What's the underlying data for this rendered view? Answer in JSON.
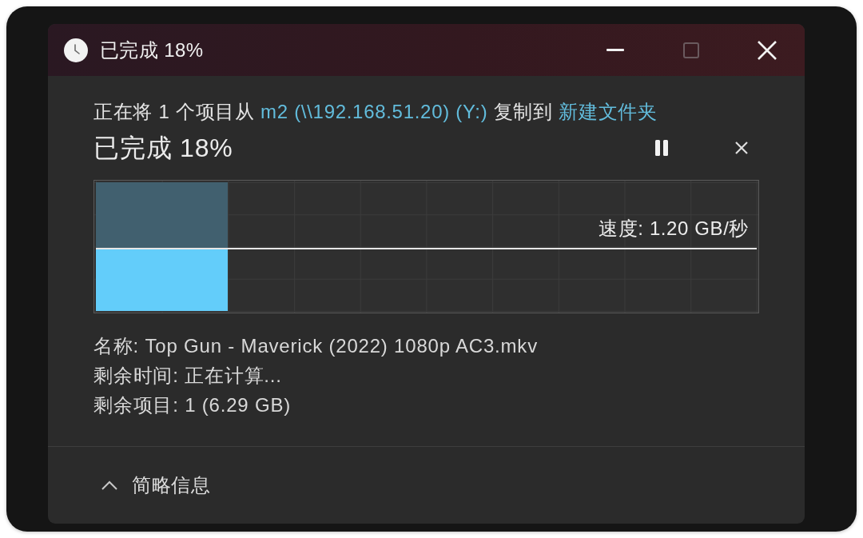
{
  "window": {
    "title": "已完成 18%",
    "controls": [
      {
        "kind": "minimize",
        "disabled": false
      },
      {
        "kind": "maximize",
        "disabled": true
      },
      {
        "kind": "close",
        "disabled": false
      }
    ]
  },
  "operation": {
    "parts": [
      {
        "kind": "text",
        "text": "正在将 1 个项目从"
      },
      {
        "kind": "link",
        "text": "m2 (\\\\192.168.51.20) (Y:)"
      },
      {
        "kind": "text",
        "text": "复制到"
      },
      {
        "kind": "link",
        "text": "新建文件夹"
      }
    ]
  },
  "status": {
    "text": "已完成 18%",
    "actions": [
      {
        "kind": "pause"
      },
      {
        "kind": "cancel"
      }
    ]
  },
  "progress": {
    "level": 0.2,
    "speed": "速度: 1.20 GB/秒"
  },
  "details": [
    "名称: Top Gun - Maverick (2022) 1080p AC3.mkv",
    "剩余时间: 正在计算...",
    "剩余项目: 1 (6.29 GB)"
  ],
  "footer": {
    "label": "简略信息",
    "expanded": true
  }
}
